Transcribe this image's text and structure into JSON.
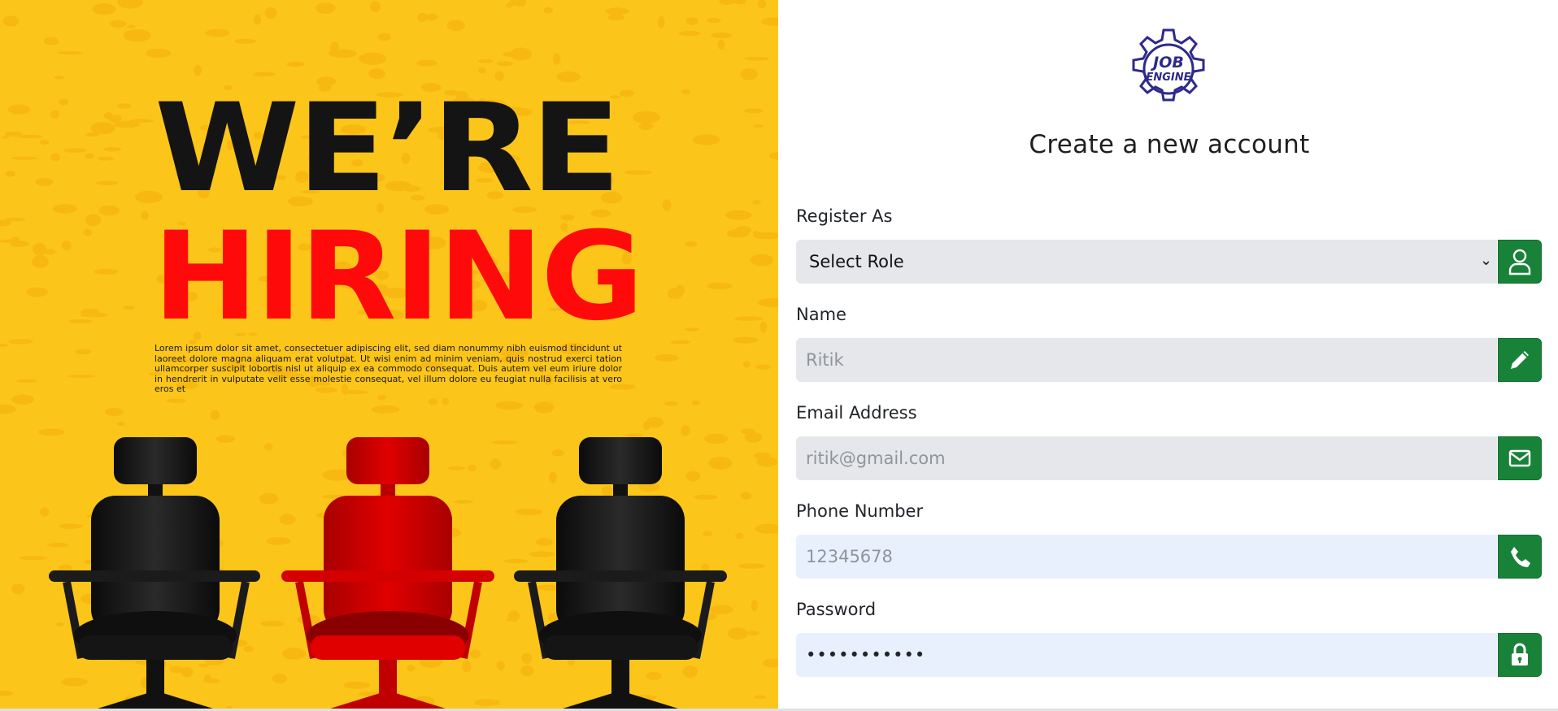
{
  "hero": {
    "title_line1": "WE’RE",
    "title_line2": "HIRING",
    "body": "Lorem ipsum dolor sit amet, consectetuer adipiscing elit, sed diam nonummy nibh euismod tincidunt ut laoreet dolore magna aliquam erat volutpat. Ut wisi enim ad minim veniam, quis nostrud exerci tation ullamcorper suscipit lobortis nisl ut aliquip ex ea commodo consequat. Duis autem vel eum iriure dolor in hendrerit in vulputate velit esse molestie consequat, vel illum dolore eu feugiat nulla facilisis at vero eros et",
    "colors": {
      "background": "#fcc51a",
      "title1": "#141414",
      "title2": "#ff0a0a"
    }
  },
  "logo": {
    "line1": "JOB",
    "line2": "ENGINE",
    "color": "#2e2a8c"
  },
  "form": {
    "title": "Create a new account",
    "role": {
      "label": "Register As",
      "selected": "Select Role",
      "icon": "user-icon"
    },
    "name": {
      "label": "Name",
      "placeholder": "Ritik",
      "icon": "pencil-icon"
    },
    "email": {
      "label": "Email Address",
      "placeholder": "ritik@gmail.com",
      "icon": "envelope-icon"
    },
    "phone": {
      "label": "Phone Number",
      "placeholder": "12345678",
      "icon": "phone-icon"
    },
    "password": {
      "label": "Password",
      "value": "•••••••••••",
      "icon": "lock-icon"
    },
    "accent": "#198239"
  }
}
